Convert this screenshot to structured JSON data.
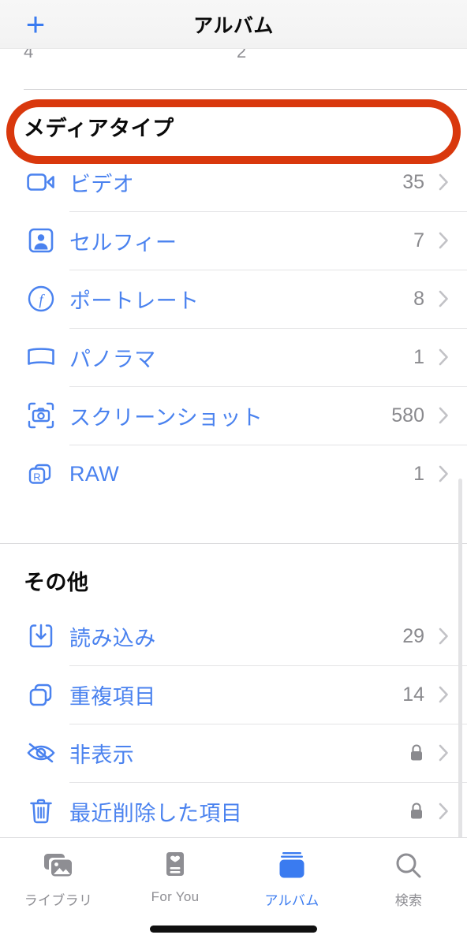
{
  "navbar": {
    "add_label": "+",
    "title": "アルバム"
  },
  "clipped_above": {
    "count_left": "4",
    "count_right": "2"
  },
  "sections": [
    {
      "title": "メディアタイプ",
      "rows": [
        {
          "icon": "video-camera-icon",
          "label": "ビデオ",
          "count": "35",
          "locked": false
        },
        {
          "icon": "selfie-person-icon",
          "label": "セルフィー",
          "count": "7",
          "locked": false
        },
        {
          "icon": "portrait-f-icon",
          "label": "ポートレート",
          "count": "8",
          "locked": false
        },
        {
          "icon": "panorama-icon",
          "label": "パノラマ",
          "count": "1",
          "locked": false
        },
        {
          "icon": "screenshot-camera-icon",
          "label": "スクリーンショット",
          "count": "580",
          "locked": false
        },
        {
          "icon": "raw-stack-icon",
          "label": "RAW",
          "count": "1",
          "locked": false
        }
      ]
    },
    {
      "title": "その他",
      "rows": [
        {
          "icon": "import-tray-icon",
          "label": "読み込み",
          "count": "29",
          "locked": false
        },
        {
          "icon": "duplicate-squares-icon",
          "label": "重複項目",
          "count": "14",
          "locked": false
        },
        {
          "icon": "eye-slash-icon",
          "label": "非表示",
          "count": "",
          "locked": true
        },
        {
          "icon": "trash-icon",
          "label": "最近削除した項目",
          "count": "",
          "locked": true
        }
      ]
    }
  ],
  "annotation": {
    "target_row_label": "ビデオ",
    "color": "#d9380d"
  },
  "tabbar": {
    "items": [
      {
        "icon": "photo-stack-icon",
        "label": "ライブラリ",
        "active": false
      },
      {
        "icon": "for-you-card-icon",
        "label": "For You",
        "active": false
      },
      {
        "icon": "albums-icon",
        "label": "アルバム",
        "active": true
      },
      {
        "icon": "search-magnifier-icon",
        "label": "検索",
        "active": false
      }
    ]
  },
  "colors": {
    "accent_blue": "#4a82ef",
    "tab_blue": "#3a7bf0",
    "count_gray": "#8a8a8e",
    "annotation_red": "#d9380d"
  }
}
